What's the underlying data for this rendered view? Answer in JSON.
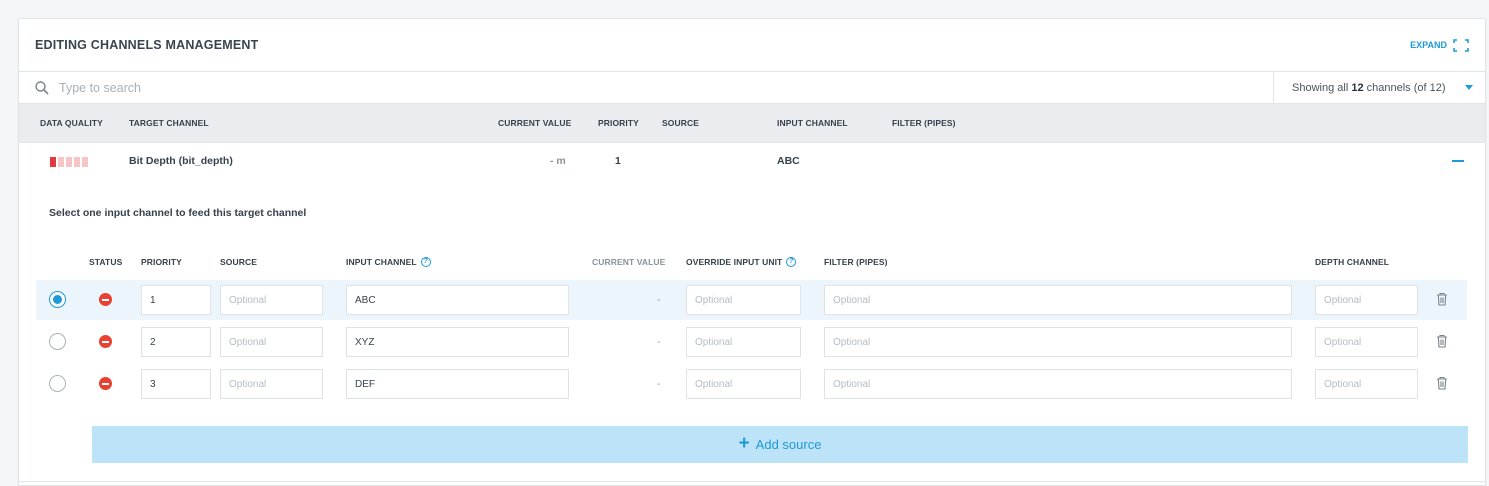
{
  "header": {
    "title": "EDITING CHANNELS MANAGEMENT",
    "expand_label": "EXPAND",
    "expand_icon": "expand-icon"
  },
  "search": {
    "placeholder": "Type to search",
    "value": "",
    "icon": "search-icon"
  },
  "counter": {
    "prefix": "Showing all ",
    "count": "12",
    "suffix": " channels (of 12)"
  },
  "columns": {
    "data_quality": "DATA QUALITY",
    "target_channel": "TARGET CHANNEL",
    "current_value": "CURRENT VALUE",
    "priority": "PRIORITY",
    "source": "SOURCE",
    "input_channel": "INPUT CHANNEL",
    "filter": "FILTER (PIPES)"
  },
  "channel": {
    "quality_bars": 5,
    "quality_filled": 1,
    "quality_color": "#e0393e",
    "name": "Bit Depth (bit_depth)",
    "current_value": "- m",
    "priority": "1",
    "source": "",
    "input_channel": "ABC"
  },
  "instruction": "Select one input channel to feed this target channel",
  "sub_columns": {
    "status": "STATUS",
    "priority": "PRIORITY",
    "source": "SOURCE",
    "input_channel": "INPUT CHANNEL",
    "current_value": "CURRENT VALUE",
    "override_unit": "OVERRIDE INPUT UNIT",
    "filter": "FILTER (PIPES)",
    "depth_channel": "DEPTH CHANNEL"
  },
  "placeholder": "Optional",
  "sources": [
    {
      "selected": true,
      "priority": "1",
      "input_channel": "ABC",
      "current_value": "-"
    },
    {
      "selected": false,
      "priority": "2",
      "input_channel": "XYZ",
      "current_value": "-"
    },
    {
      "selected": false,
      "priority": "3",
      "input_channel": "DEF",
      "current_value": "-"
    }
  ],
  "add_source_label": "Add source",
  "colors": {
    "accent": "#1e9ad6",
    "error": "#e94032",
    "add_bg": "#bde3f8"
  }
}
